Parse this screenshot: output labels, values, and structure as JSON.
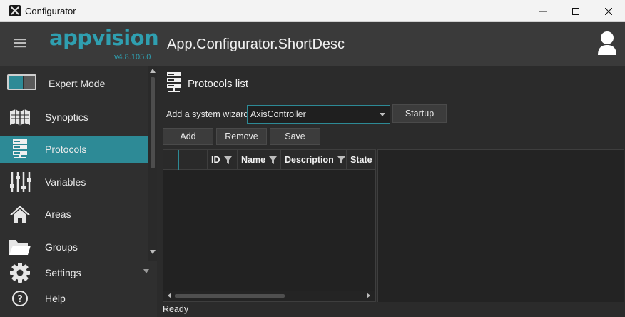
{
  "window": {
    "title": "Configurator"
  },
  "header": {
    "logo": "appvision",
    "version": "v4.8.105.0",
    "app_title": "App.Configurator.ShortDesc"
  },
  "sidebar": {
    "expert_mode_label": "Expert Mode",
    "items": [
      {
        "label": "Synoptics",
        "icon": "map-icon"
      },
      {
        "label": "Protocols",
        "icon": "server-icon",
        "active": true
      },
      {
        "label": "Variables",
        "icon": "sliders-icon"
      },
      {
        "label": "Areas",
        "icon": "home-icon"
      },
      {
        "label": "Groups",
        "icon": "folder-icon"
      },
      {
        "label": "Settings",
        "icon": "gear-icon"
      },
      {
        "label": "Help",
        "icon": "help-icon"
      }
    ]
  },
  "main": {
    "title": "Protocols list",
    "wizard_label": "Add a system wizard",
    "wizard_value": "AxisController",
    "startup_label": "Startup",
    "add_label": "Add",
    "remove_label": "Remove",
    "save_label": "Save",
    "columns": [
      "ID",
      "Name",
      "Description",
      "State"
    ],
    "status": "Ready"
  },
  "colors": {
    "accent": "#2d8a96",
    "logo": "#2f9fb0"
  }
}
